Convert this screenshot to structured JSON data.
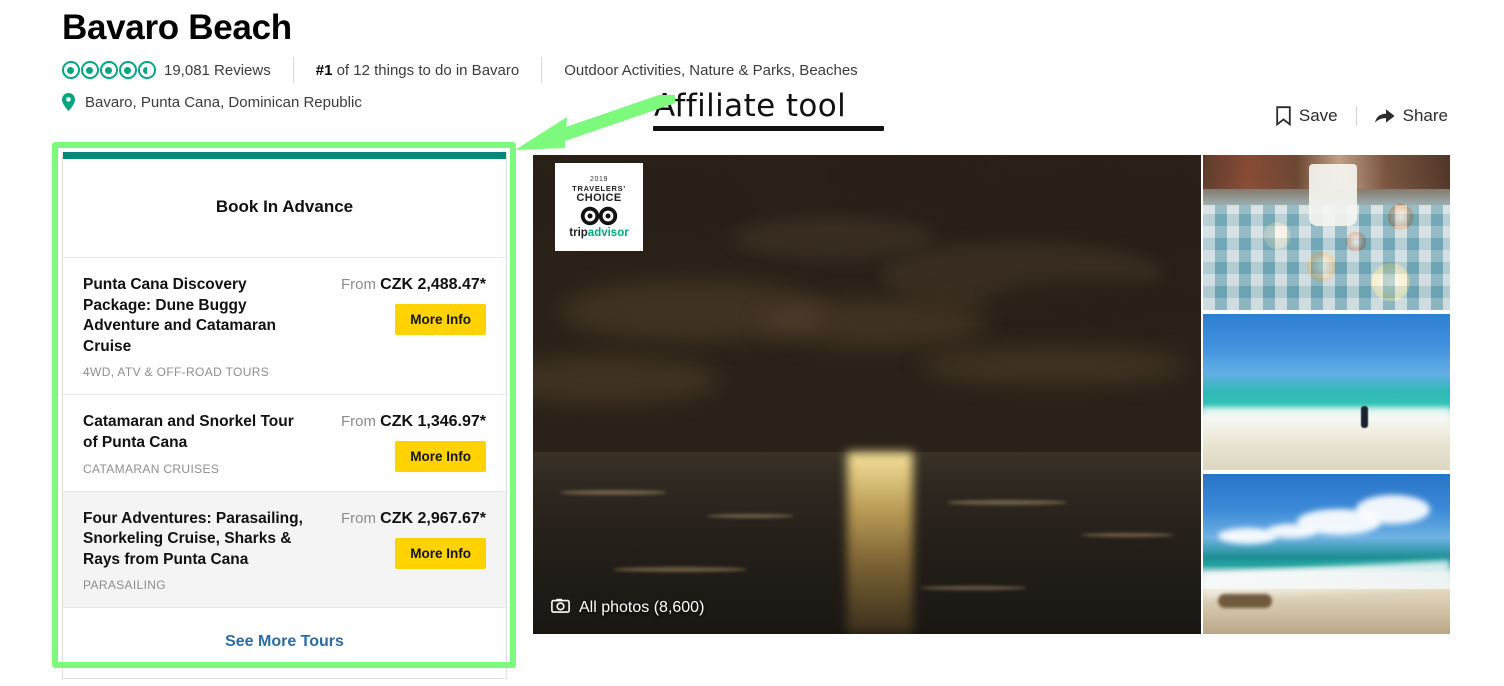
{
  "header": {
    "title": "Bavaro Beach",
    "rating": 4.5,
    "bubble_count": 5,
    "review_count_text": "19,081 Reviews",
    "rank_prefix": "#1",
    "rank_suffix": " of 12 things to do in Bavaro",
    "categories": "Outdoor Activities, Nature & Parks, Beaches",
    "location": "Bavaro, Punta Cana, Dominican Republic",
    "pin_icon": "location-pin-icon",
    "accent_color": "#00a680"
  },
  "actions": {
    "save_label": "Save",
    "save_icon": "bookmark-icon",
    "share_label": "Share",
    "share_icon": "share-arrow-icon"
  },
  "annotation": {
    "text": "Affiliate tool",
    "arrow_color": "#7dfa7d",
    "box_color": "#7dfa7d"
  },
  "widget": {
    "title": "Book In Advance",
    "topbar_color": "#00897b",
    "price_prefix": "From",
    "button_label": "More Info",
    "button_color": "#ffd200",
    "see_more_label": "See More Tours",
    "see_more_color": "#2b6ca3",
    "tours": [
      {
        "name": "Punta Cana Discovery Package: Dune Buggy Adventure and Catamaran Cruise",
        "category": "4WD, ATV & OFF-ROAD TOURS",
        "price": "CZK 2,488.47*",
        "shaded": false
      },
      {
        "name": "Catamaran and Snorkel Tour of Punta Cana",
        "category": "CATAMARAN CRUISES",
        "price": "CZK 1,346.97*",
        "shaded": false
      },
      {
        "name": "Four Adventures: Parasailing, Snorkeling Cruise, Sharks & Rays from Punta Cana",
        "category": "PARASAILING",
        "price": "CZK 2,967.67*",
        "shaded": true
      }
    ]
  },
  "gallery": {
    "all_photos_label": "All photos (8,600)",
    "camera_icon": "camera-icon",
    "hero_alt": "sunset-over-ocean",
    "badge": {
      "year": "2019",
      "line1": "TRAVELERS'",
      "line2": "CHOICE",
      "brand_part1": "trip",
      "brand_part2": "advisor",
      "owl_icon": "tripadvisor-owl-icon"
    },
    "thumbnails": [
      {
        "alt": "dining-table-with-food"
      },
      {
        "alt": "turquoise-beach-with-swimmer"
      },
      {
        "alt": "beach-with-clouds-and-surf"
      }
    ]
  }
}
